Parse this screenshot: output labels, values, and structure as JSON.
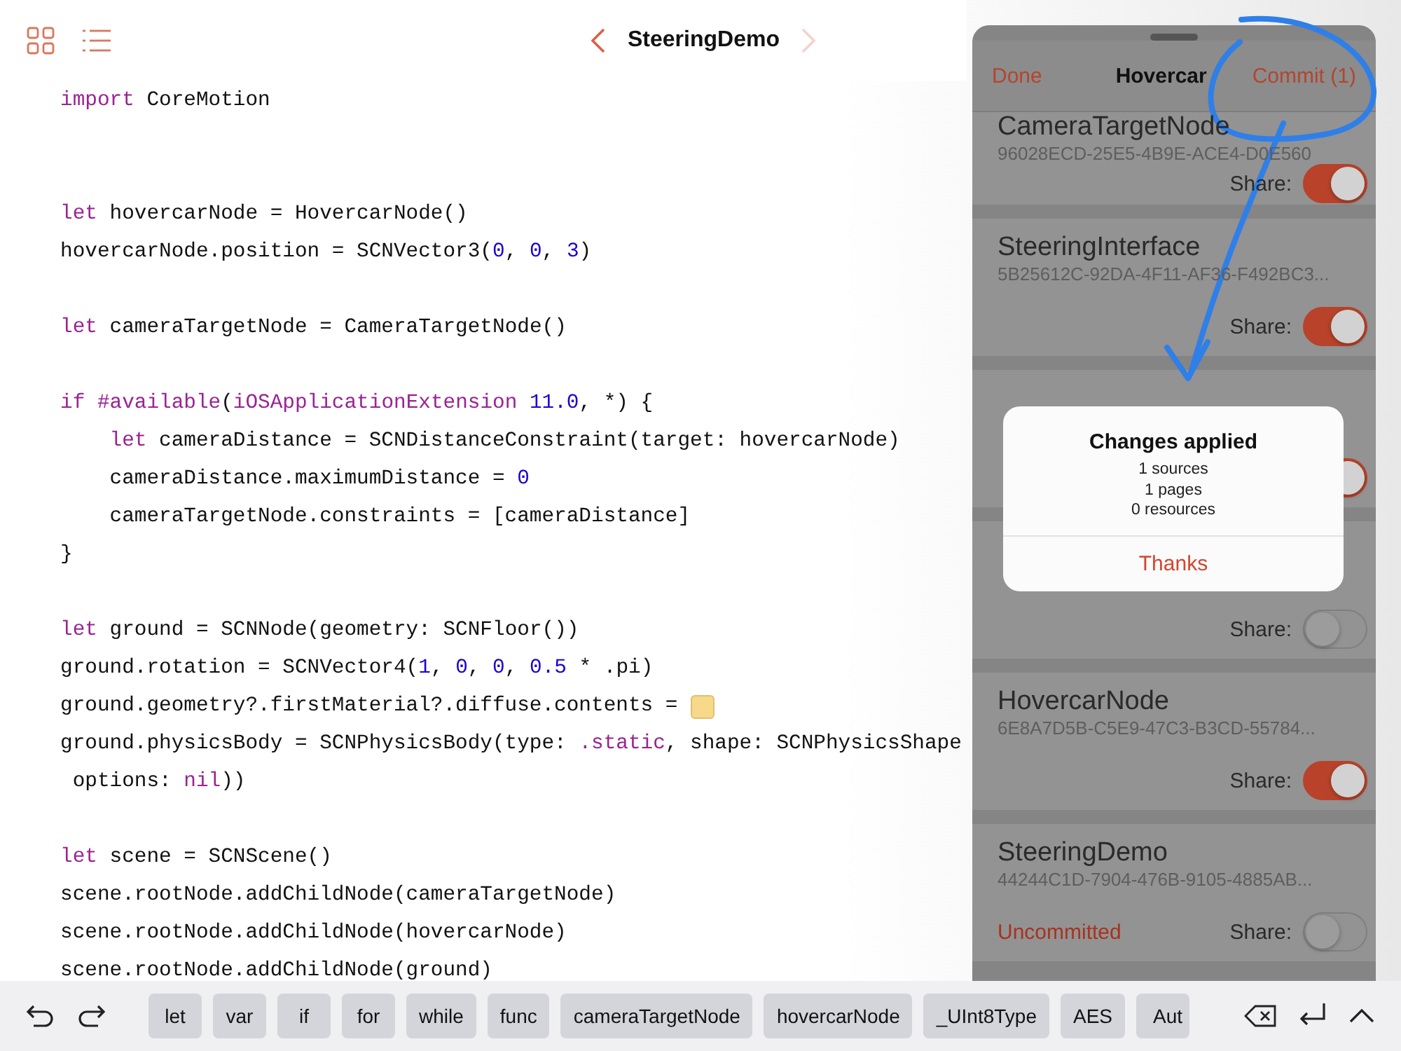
{
  "toolbar": {
    "title": "SteeringDemo",
    "back_enabled": true,
    "forward_enabled": false
  },
  "code_lines": [
    {
      "kind": "code",
      "tokens": [
        {
          "kind": "kw",
          "t": "import"
        },
        {
          "kind": "plain",
          "t": " CoreMotion"
        }
      ]
    },
    {
      "kind": "blank"
    },
    {
      "kind": "blank"
    },
    {
      "kind": "code",
      "tokens": [
        {
          "kind": "kw",
          "t": "let"
        },
        {
          "kind": "plain",
          "t": " hovercarNode = HovercarNode()"
        }
      ]
    },
    {
      "kind": "code",
      "tokens": [
        {
          "kind": "plain",
          "t": "hovercarNode.position = SCNVector3("
        },
        {
          "kind": "num",
          "t": "0"
        },
        {
          "kind": "plain",
          "t": ", "
        },
        {
          "kind": "num",
          "t": "0"
        },
        {
          "kind": "plain",
          "t": ", "
        },
        {
          "kind": "num",
          "t": "3"
        },
        {
          "kind": "plain",
          "t": ")"
        }
      ]
    },
    {
      "kind": "blank"
    },
    {
      "kind": "code",
      "tokens": [
        {
          "kind": "kw",
          "t": "let"
        },
        {
          "kind": "plain",
          "t": " cameraTargetNode = CameraTargetNode()"
        }
      ]
    },
    {
      "kind": "blank"
    },
    {
      "kind": "code",
      "tokens": [
        {
          "kind": "kw",
          "t": "if #available"
        },
        {
          "kind": "plain",
          "t": "("
        },
        {
          "kind": "kw",
          "t": "iOSApplicationExtension"
        },
        {
          "kind": "num",
          "t": " 11.0"
        },
        {
          "kind": "plain",
          "t": ", *) {"
        }
      ]
    },
    {
      "kind": "code",
      "tokens": [
        {
          "kind": "kw",
          "t": "    let"
        },
        {
          "kind": "plain",
          "t": " cameraDistance = SCNDistanceConstraint(target: hovercarNode)"
        }
      ]
    },
    {
      "kind": "code",
      "tokens": [
        {
          "kind": "plain",
          "t": "    cameraDistance.maximumDistance = "
        },
        {
          "kind": "num",
          "t": "0"
        }
      ]
    },
    {
      "kind": "code",
      "tokens": [
        {
          "kind": "plain",
          "t": "    cameraTargetNode.constraints = [cameraDistance]"
        }
      ]
    },
    {
      "kind": "code",
      "tokens": [
        {
          "kind": "plain",
          "t": "}"
        }
      ]
    },
    {
      "kind": "blank"
    },
    {
      "kind": "code",
      "tokens": [
        {
          "kind": "kw",
          "t": "let"
        },
        {
          "kind": "plain",
          "t": " ground = SCNNode(geometry: SCNFloor())"
        }
      ]
    },
    {
      "kind": "code",
      "tokens": [
        {
          "kind": "plain",
          "t": "ground.rotation = SCNVector4("
        },
        {
          "kind": "num",
          "t": "1"
        },
        {
          "kind": "plain",
          "t": ", "
        },
        {
          "kind": "num",
          "t": "0"
        },
        {
          "kind": "plain",
          "t": ", "
        },
        {
          "kind": "num",
          "t": "0"
        },
        {
          "kind": "plain",
          "t": ", "
        },
        {
          "kind": "num",
          "t": "0.5"
        },
        {
          "kind": "plain",
          "t": " * .pi)"
        }
      ]
    },
    {
      "kind": "code",
      "tokens": [
        {
          "kind": "plain",
          "t": "ground.geometry?.firstMaterial?.diffuse.contents = "
        },
        {
          "kind": "swatch",
          "color": "#f7d98a"
        }
      ]
    },
    {
      "kind": "code",
      "tokens": [
        {
          "kind": "plain",
          "t": "ground.physicsBody = SCNPhysicsBody(type: "
        },
        {
          "kind": "kw",
          "t": ".static"
        },
        {
          "kind": "plain",
          "t": ", shape: SCNPhysicsShape"
        }
      ]
    },
    {
      "kind": "code",
      "tokens": [
        {
          "kind": "plain",
          "t": " options: "
        },
        {
          "kind": "kw",
          "t": "nil"
        },
        {
          "kind": "plain",
          "t": "))"
        }
      ]
    },
    {
      "kind": "blank"
    },
    {
      "kind": "code",
      "tokens": [
        {
          "kind": "kw",
          "t": "let"
        },
        {
          "kind": "plain",
          "t": " scene = SCNScene()"
        }
      ]
    },
    {
      "kind": "code",
      "tokens": [
        {
          "kind": "plain",
          "t": "scene.rootNode.addChildNode(cameraTargetNode)"
        }
      ]
    },
    {
      "kind": "code",
      "tokens": [
        {
          "kind": "plain",
          "t": "scene.rootNode.addChildNode(hovercarNode)"
        }
      ]
    },
    {
      "kind": "code",
      "tokens": [
        {
          "kind": "plain",
          "t": "scene.rootNode.addChildNode(ground)"
        }
      ]
    }
  ],
  "panel": {
    "done": "Done",
    "title": "Hovercar",
    "commit": "Commit (1)",
    "cards": [
      {
        "name": "CameraTargetNode",
        "id": "96028ECD-25E5-4B9E-ACE4-D0E560",
        "share_label": "Share:",
        "on": true
      },
      {
        "name": "SteeringInterface",
        "id": "5B25612C-92DA-4F11-AF36-F492BC3...",
        "share_label": "Share:",
        "on": true
      },
      {
        "on": true
      },
      {
        "share_label": "Share:",
        "on": false
      },
      {
        "name": "HovercarNode",
        "id": "6E8A7D5B-C5E9-47C3-B3CD-55784...",
        "share_label": "Share:",
        "on": true
      },
      {
        "name": "SteeringDemo",
        "id": "44244C1D-7904-476B-9105-4885AB...",
        "status": "Uncommitted",
        "share_label": "Share:",
        "on": false
      }
    ]
  },
  "alert": {
    "title": "Changes applied",
    "lines": [
      "1 sources",
      "1 pages",
      "0 resources"
    ],
    "button": "Thanks"
  },
  "keyboard_bar": {
    "keys": [
      "let",
      "var",
      "if",
      "for",
      "while",
      "func",
      "cameraTargetNode",
      "hovercarNode",
      "_UInt8Type",
      "AES",
      "Aut"
    ]
  }
}
